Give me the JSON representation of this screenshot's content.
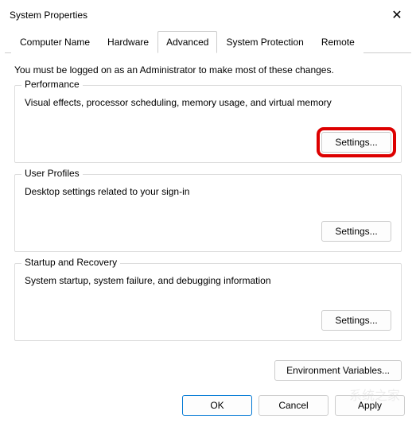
{
  "window": {
    "title": "System Properties"
  },
  "tabs": {
    "computer_name": "Computer Name",
    "hardware": "Hardware",
    "advanced": "Advanced",
    "system_protection": "System Protection",
    "remote": "Remote"
  },
  "admin_note": "You must be logged on as an Administrator to make most of these changes.",
  "performance": {
    "title": "Performance",
    "desc": "Visual effects, processor scheduling, memory usage, and virtual memory",
    "button": "Settings..."
  },
  "user_profiles": {
    "title": "User Profiles",
    "desc": "Desktop settings related to your sign-in",
    "button": "Settings..."
  },
  "startup_recovery": {
    "title": "Startup and Recovery",
    "desc": "System startup, system failure, and debugging information",
    "button": "Settings..."
  },
  "env_button": "Environment Variables...",
  "dialog": {
    "ok": "OK",
    "cancel": "Cancel",
    "apply": "Apply"
  },
  "watermark": "系统之家"
}
